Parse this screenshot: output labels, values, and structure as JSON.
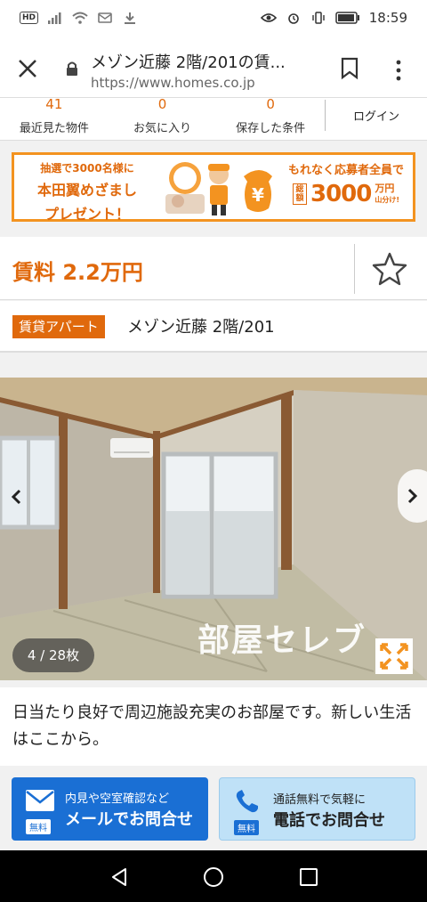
{
  "status_bar": {
    "hd": "HD",
    "time": "18:59"
  },
  "browser": {
    "title": "メゾン近藤 2階/201の賃...",
    "url": "https://www.homes.co.jp"
  },
  "counters": [
    {
      "num": "41",
      "label": "最近見た物件"
    },
    {
      "num": "0",
      "label": "お気に入り"
    },
    {
      "num": "0",
      "label": "保存した条件"
    }
  ],
  "login_label": "ログイン",
  "banner": {
    "line1": "抽選で3000名様に",
    "line2": "本田翼めざまし",
    "line3": "プレゼント！",
    "line4": "もれなく応募者全員で",
    "total": "総額",
    "amount": "3000",
    "unit1": "万円",
    "unit2": "山分け!"
  },
  "listing": {
    "price": "賃料 2.2万円",
    "type_tag": "賃貸アパート",
    "name": "メゾン近藤 2階/201",
    "photo_counter": "4 / 28枚",
    "watermark": "部屋セレブ",
    "description": "日当たり良好で周辺施設充実のお部屋です。新しい生活はここから。"
  },
  "contact": {
    "mail_sub": "内見や空室確認など",
    "mail_main": "メールでお問合せ",
    "tel_sub": "通話無料で気軽に",
    "tel_main": "電話でお問合せ",
    "free": "無料"
  },
  "colors": {
    "accent": "#e0690c",
    "mail_button": "#1a6fd4",
    "tel_button": "#bfe1f7"
  }
}
